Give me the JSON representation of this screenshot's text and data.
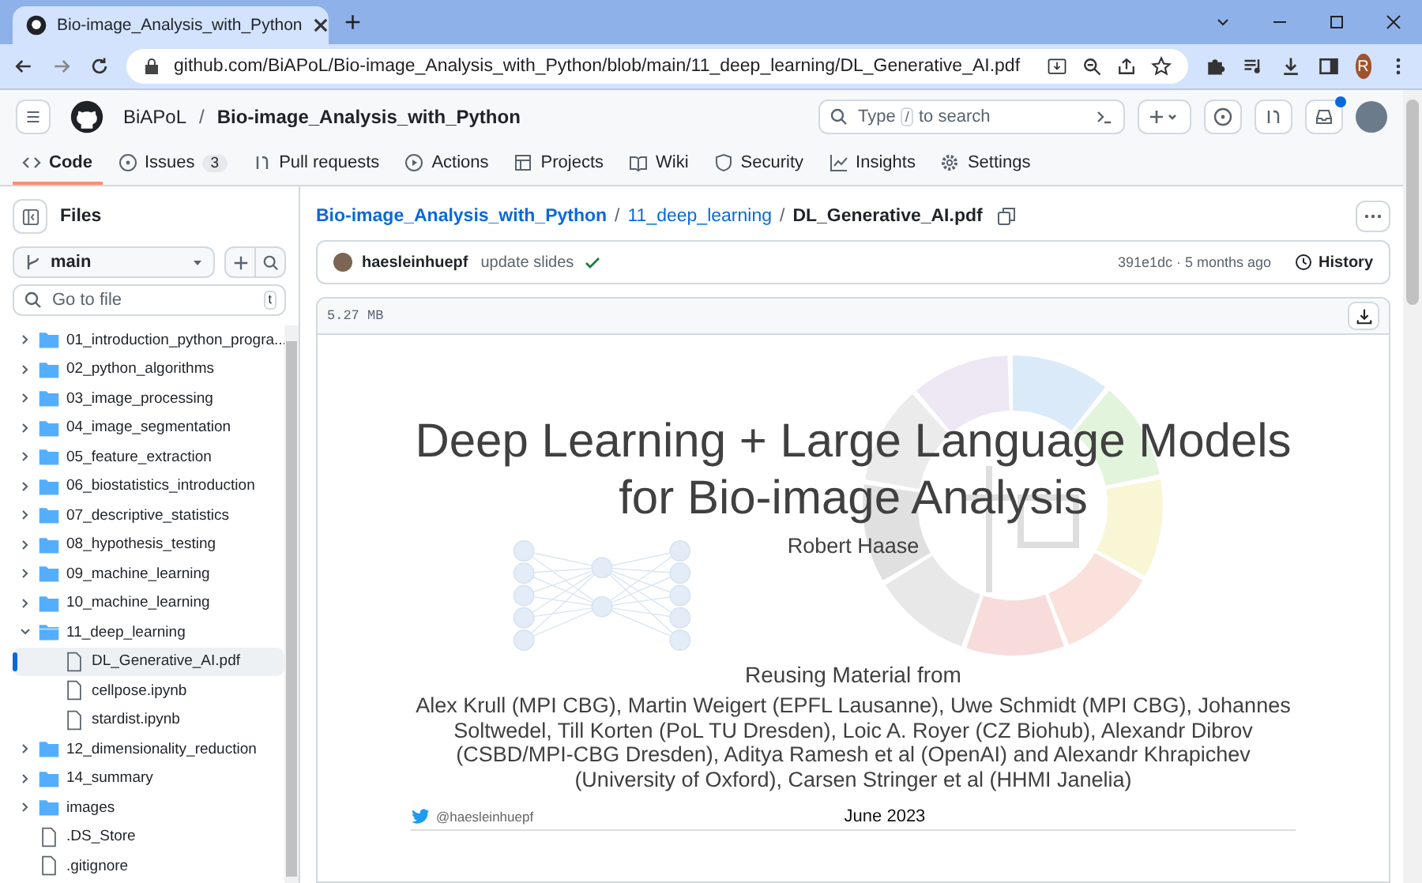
{
  "browser": {
    "tab_title": "Bio-image_Analysis_with_Python",
    "new_tab": "+",
    "url": "github.com/BiAPoL/Bio-image_Analysis_with_Python/blob/main/11_deep_learning/DL_Generative_AI.pdf",
    "profile_initial": "R"
  },
  "header": {
    "owner": "BiAPoL",
    "separator": "/",
    "repo": "Bio-image_Analysis_with_Python",
    "search": {
      "before": "Type",
      "key": "/",
      "after": "to search"
    },
    "has_notification": true
  },
  "nav_tabs": [
    {
      "label": "Code",
      "selected": true
    },
    {
      "label": "Issues",
      "count": "3",
      "selected": false
    },
    {
      "label": "Pull requests",
      "selected": false
    },
    {
      "label": "Actions",
      "selected": false
    },
    {
      "label": "Projects",
      "selected": false
    },
    {
      "label": "Wiki",
      "selected": false
    },
    {
      "label": "Security",
      "selected": false
    },
    {
      "label": "Insights",
      "selected": false
    },
    {
      "label": "Settings",
      "selected": false
    }
  ],
  "files": {
    "title": "Files",
    "branch": "main",
    "filter_placeholder": "Go to file",
    "filter_key": "t",
    "tree": [
      {
        "name": "01_introduction_python_progra...",
        "kind": "folder",
        "expanded": false,
        "selected": false
      },
      {
        "name": "02_python_algorithms",
        "kind": "folder",
        "expanded": false,
        "selected": false
      },
      {
        "name": "03_image_processing",
        "kind": "folder",
        "expanded": false,
        "selected": false
      },
      {
        "name": "04_image_segmentation",
        "kind": "folder",
        "expanded": false,
        "selected": false
      },
      {
        "name": "05_feature_extraction",
        "kind": "folder",
        "expanded": false,
        "selected": false
      },
      {
        "name": "06_biostatistics_introduction",
        "kind": "folder",
        "expanded": false,
        "selected": false
      },
      {
        "name": "07_descriptive_statistics",
        "kind": "folder",
        "expanded": false,
        "selected": false
      },
      {
        "name": "08_hypothesis_testing",
        "kind": "folder",
        "expanded": false,
        "selected": false
      },
      {
        "name": "09_machine_learning",
        "kind": "folder",
        "expanded": false,
        "selected": false
      },
      {
        "name": "10_machine_learning",
        "kind": "folder",
        "expanded": false,
        "selected": false
      },
      {
        "name": "11_deep_learning",
        "kind": "folder",
        "expanded": true,
        "selected": false,
        "children": [
          {
            "name": "DL_Generative_AI.pdf",
            "kind": "file",
            "selected": true
          },
          {
            "name": "cellpose.ipynb",
            "kind": "file",
            "selected": false
          },
          {
            "name": "stardist.ipynb",
            "kind": "file",
            "selected": false
          }
        ]
      },
      {
        "name": "12_dimensionality_reduction",
        "kind": "folder",
        "expanded": false,
        "selected": false
      },
      {
        "name": "14_summary",
        "kind": "folder",
        "expanded": false,
        "selected": false
      },
      {
        "name": "images",
        "kind": "folder",
        "expanded": false,
        "selected": false
      },
      {
        "name": ".DS_Store",
        "kind": "file",
        "selected": false
      },
      {
        "name": ".gitignore",
        "kind": "file",
        "selected": false
      }
    ]
  },
  "breadcrumb": {
    "links": [
      "Bio-image_Analysis_with_Python",
      "11_deep_learning"
    ],
    "separator": "/",
    "file": "DL_Generative_AI.pdf"
  },
  "commit": {
    "author": "haesleinhuepf",
    "message": "update slides",
    "checks_passed": true,
    "meta": "391e1dc · 5 months ago",
    "history": "History"
  },
  "file": {
    "size": "5.27 MB"
  },
  "slide": {
    "title": [
      "Deep Learning + Large Language Models",
      "for Bio-image Analysis"
    ],
    "author": "Robert Haase",
    "reuse_heading": "Reusing Material from",
    "credits": "Alex Krull (MPI CBG), Martin Weigert (EPFL Lausanne), Uwe Schmidt (MPI CBG), Johannes Soltwedel, Till Korten (PoL TU Dresden), Loic A. Royer (CZ Biohub), Alexandr Dibrov (CSBD/MPI-CBG Dresden), Aditya Ramesh et al (OpenAI) and Alexandr Khrapichev (University of Oxford), Carsen Stringer et al (HHMI Janelia)",
    "handle": "@haesleinhuepf",
    "date": "June 2023"
  }
}
